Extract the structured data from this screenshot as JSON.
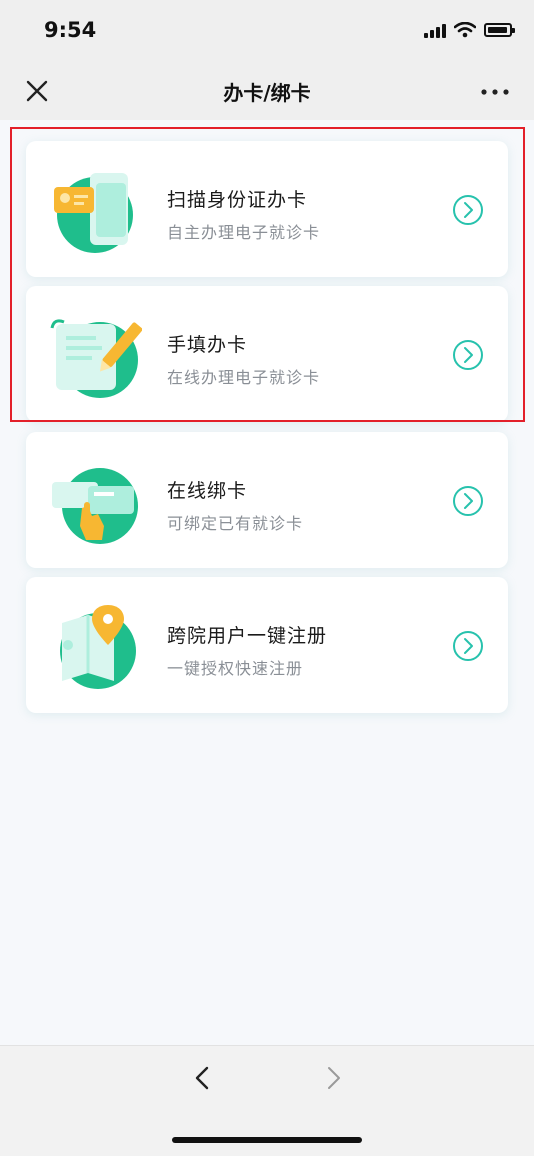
{
  "status_bar": {
    "time": "9:54"
  },
  "nav": {
    "title": "办卡/绑卡",
    "close_icon": "close-icon",
    "more_icon": "more-icon"
  },
  "colors": {
    "accent_green": "#1fbe8c",
    "arrow_teal": "#27c2ad",
    "highlight_red": "#e3202a",
    "gold": "#f7b732"
  },
  "cards": [
    {
      "title": "扫描身份证办卡",
      "subtitle": "自主办理电子就诊卡",
      "icon": "id-card-scan-icon"
    },
    {
      "title": "手填办卡",
      "subtitle": "在线办理电子就诊卡",
      "icon": "manual-fill-icon"
    },
    {
      "title": "在线绑卡",
      "subtitle": "可绑定已有就诊卡",
      "icon": "bind-card-icon"
    },
    {
      "title": "跨院用户一键注册",
      "subtitle": "一键授权快速注册",
      "icon": "cross-hospital-register-icon"
    }
  ],
  "toolbar": {
    "back_icon": "back-arrow-icon",
    "forward_icon": "forward-arrow-icon"
  }
}
